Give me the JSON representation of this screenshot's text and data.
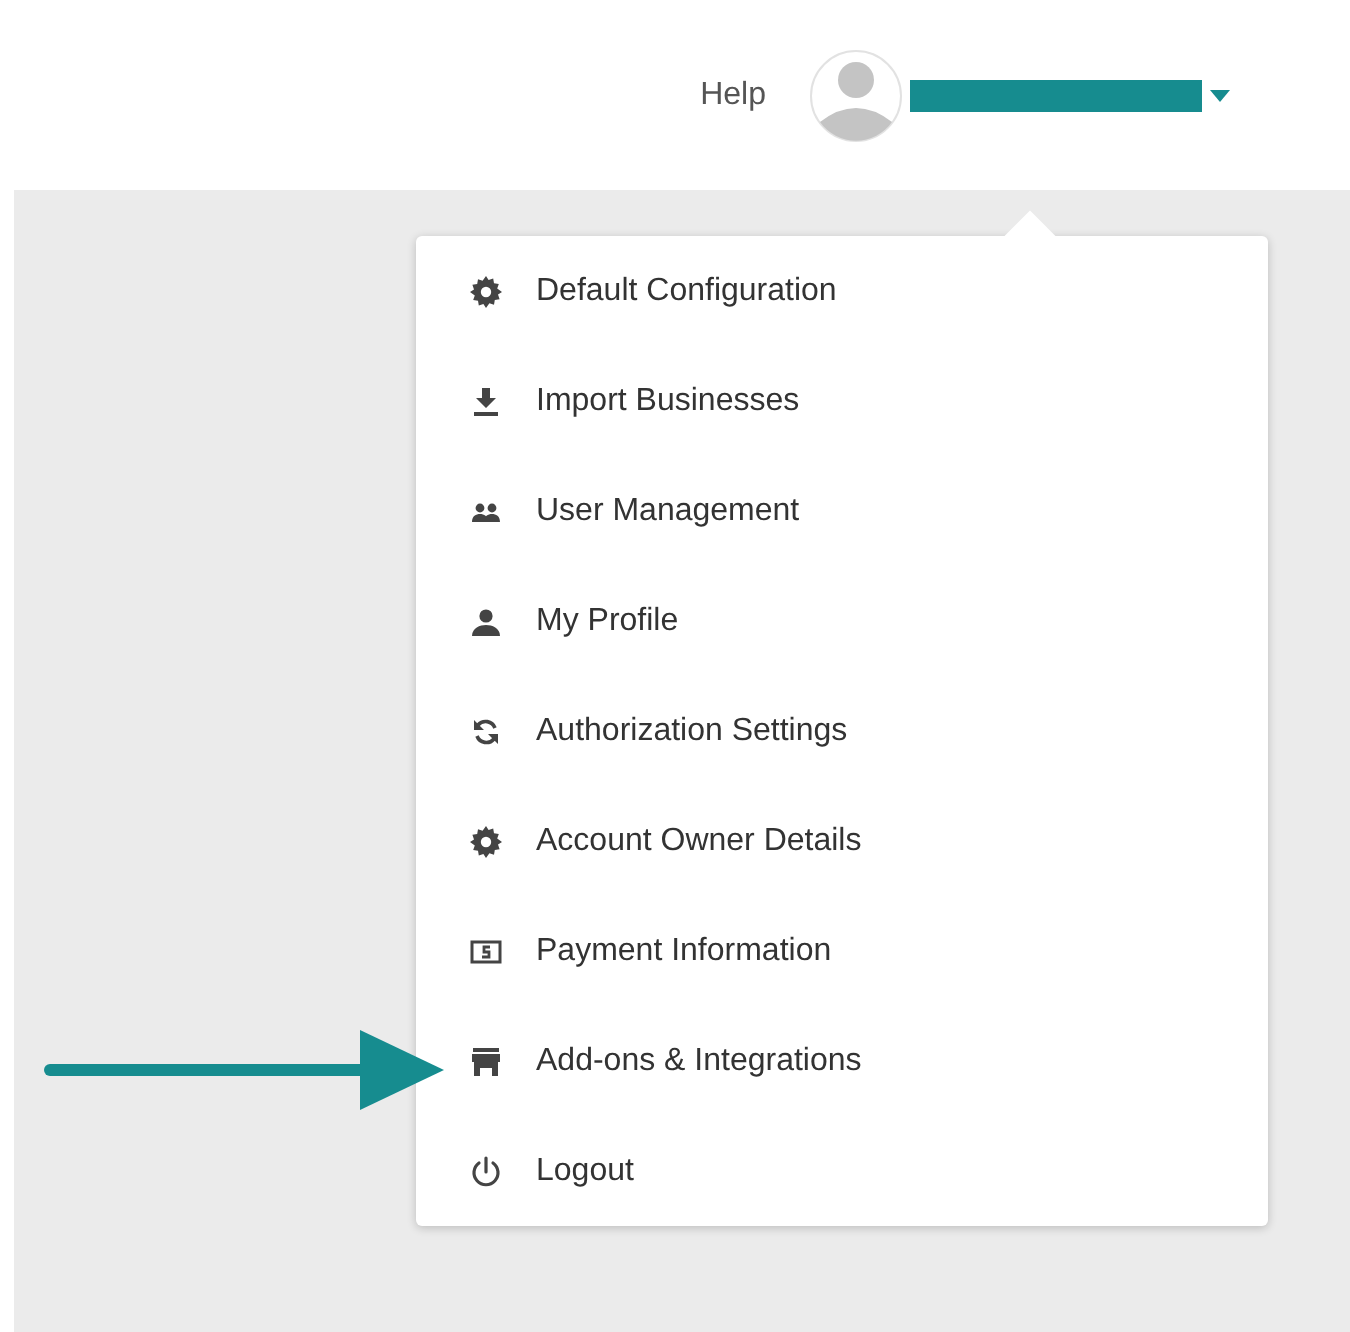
{
  "header": {
    "help": "Help"
  },
  "menu": {
    "items": [
      {
        "label": "Default Configuration",
        "kind": "gear"
      },
      {
        "label": "Import Businesses",
        "kind": "download"
      },
      {
        "label": "User Management",
        "kind": "group"
      },
      {
        "label": "My Profile",
        "kind": "person"
      },
      {
        "label": "Authorization Settings",
        "kind": "sync"
      },
      {
        "label": "Account Owner Details",
        "kind": "gear"
      },
      {
        "label": "Payment Information",
        "kind": "money"
      },
      {
        "label": "Add-ons & Integrations",
        "kind": "store"
      },
      {
        "label": "Logout",
        "kind": "power"
      }
    ]
  }
}
